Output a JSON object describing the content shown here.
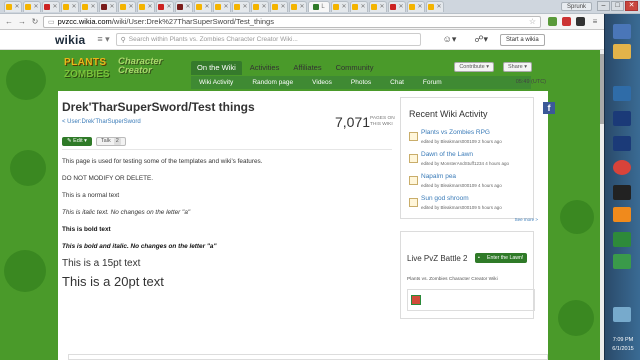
{
  "browser": {
    "url_prefix": "pvzcc.wikia.com",
    "url_path": "/wiki/User:Drek%27TharSuperSword/Test_things",
    "user_button": "Sprunk",
    "active_tab_label": "L"
  },
  "wikia": {
    "logo": "wikia",
    "search_placeholder": "Search within Plants vs. Zombies Character Creator Wiki...",
    "start_wiki": "Start a wikia"
  },
  "community": {
    "logo_line1": "PLANTS",
    "logo_line2": "ZOMBIES",
    "logo_line3": "Character Creator",
    "tabs": [
      "On the Wiki",
      "Activities",
      "Affiliates",
      "Community"
    ],
    "subnav": [
      "Wiki Activity",
      "Random page",
      "Videos",
      "Photos",
      "Chat",
      "Forum"
    ],
    "contribute": "Contribute",
    "share": "Share",
    "time_badge": "05:49 (UTC)"
  },
  "article": {
    "title": "Drek'TharSuperSword/Test things",
    "back_link": "< User:Drek'TharSuperSword",
    "page_count": "7,071",
    "page_count_label_1": "PAGES ON",
    "page_count_label_2": "THIS WIKI",
    "edit_label": "Edit",
    "talk_label": "Talk",
    "talk_count": "2",
    "lines": {
      "intro": "This page is used for testing some of the templates and wiki's features.",
      "warning": "DO NOT MODIFY OR DELETE.",
      "normal": "This is a normal text",
      "italic": "This is italic text. No changes on the letter \"a\"",
      "bold": "This is bold text",
      "bolditalic": "This is bold and italic. No changes on the letter \"a\"",
      "pt15": "This is a 15pt text",
      "pt20": "This is a 20pt text"
    }
  },
  "rail": {
    "title": "Recent Wiki Activity",
    "items": [
      {
        "title": "Plants vs Zombies RPG",
        "meta": "edited by Bleakmars000109 2 hours ago"
      },
      {
        "title": "Dawn of the Lawn",
        "meta": "edited by MonsterAndStuff1234 4 hours ago"
      },
      {
        "title": "Napalm pea",
        "meta": "edited by Bleakmars000109 4 hours ago"
      },
      {
        "title": "Sun god shroom",
        "meta": "edited by Bleakmars000109 5 hours ago"
      }
    ],
    "see_more": "See more >",
    "live_title": "Live PvZ Battle 2",
    "enter_lawn": "Enter the Lawn!",
    "live_sub": "Plants vs. Zombies Character Creator Wiki"
  },
  "taskbar": {
    "time": "7:09 PM",
    "date": "6/1/2015"
  },
  "colors": {
    "accent_green": "#357a2c",
    "link_blue": "#3a7bb8",
    "facebook": "#3b5998"
  }
}
